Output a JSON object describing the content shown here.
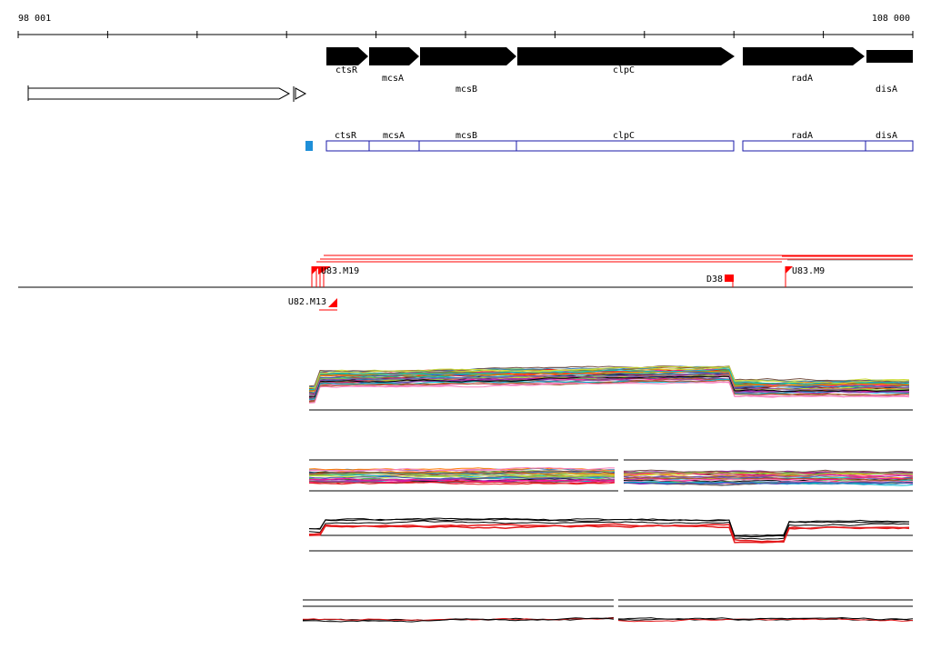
{
  "ruler": {
    "start_label": "98 001",
    "end_label": "108 000"
  },
  "genes": [
    {
      "name": "ctsR",
      "strand": "+"
    },
    {
      "name": "mcsA",
      "strand": "+"
    },
    {
      "name": "mcsB",
      "strand": "+"
    },
    {
      "name": "clpC",
      "strand": "+"
    },
    {
      "name": "radA",
      "strand": "+"
    },
    {
      "name": "disA",
      "strand": "+"
    }
  ],
  "annotation_track": [
    "ctsR",
    "mcsA",
    "mcsB",
    "clpC",
    "radA",
    "disA"
  ],
  "markers": [
    {
      "label": "U83.M19",
      "side": "above"
    },
    {
      "label": "D38",
      "side": "above"
    },
    {
      "label": "U83.M9",
      "side": "above"
    },
    {
      "label": "U82.M13",
      "side": "below"
    }
  ],
  "colors": {
    "gene_arrow": "#000000",
    "annotation_box": "#1a1aa8",
    "small_marker": "#1e8fd8",
    "feature": "#ff0000",
    "axis": "#000000"
  }
}
